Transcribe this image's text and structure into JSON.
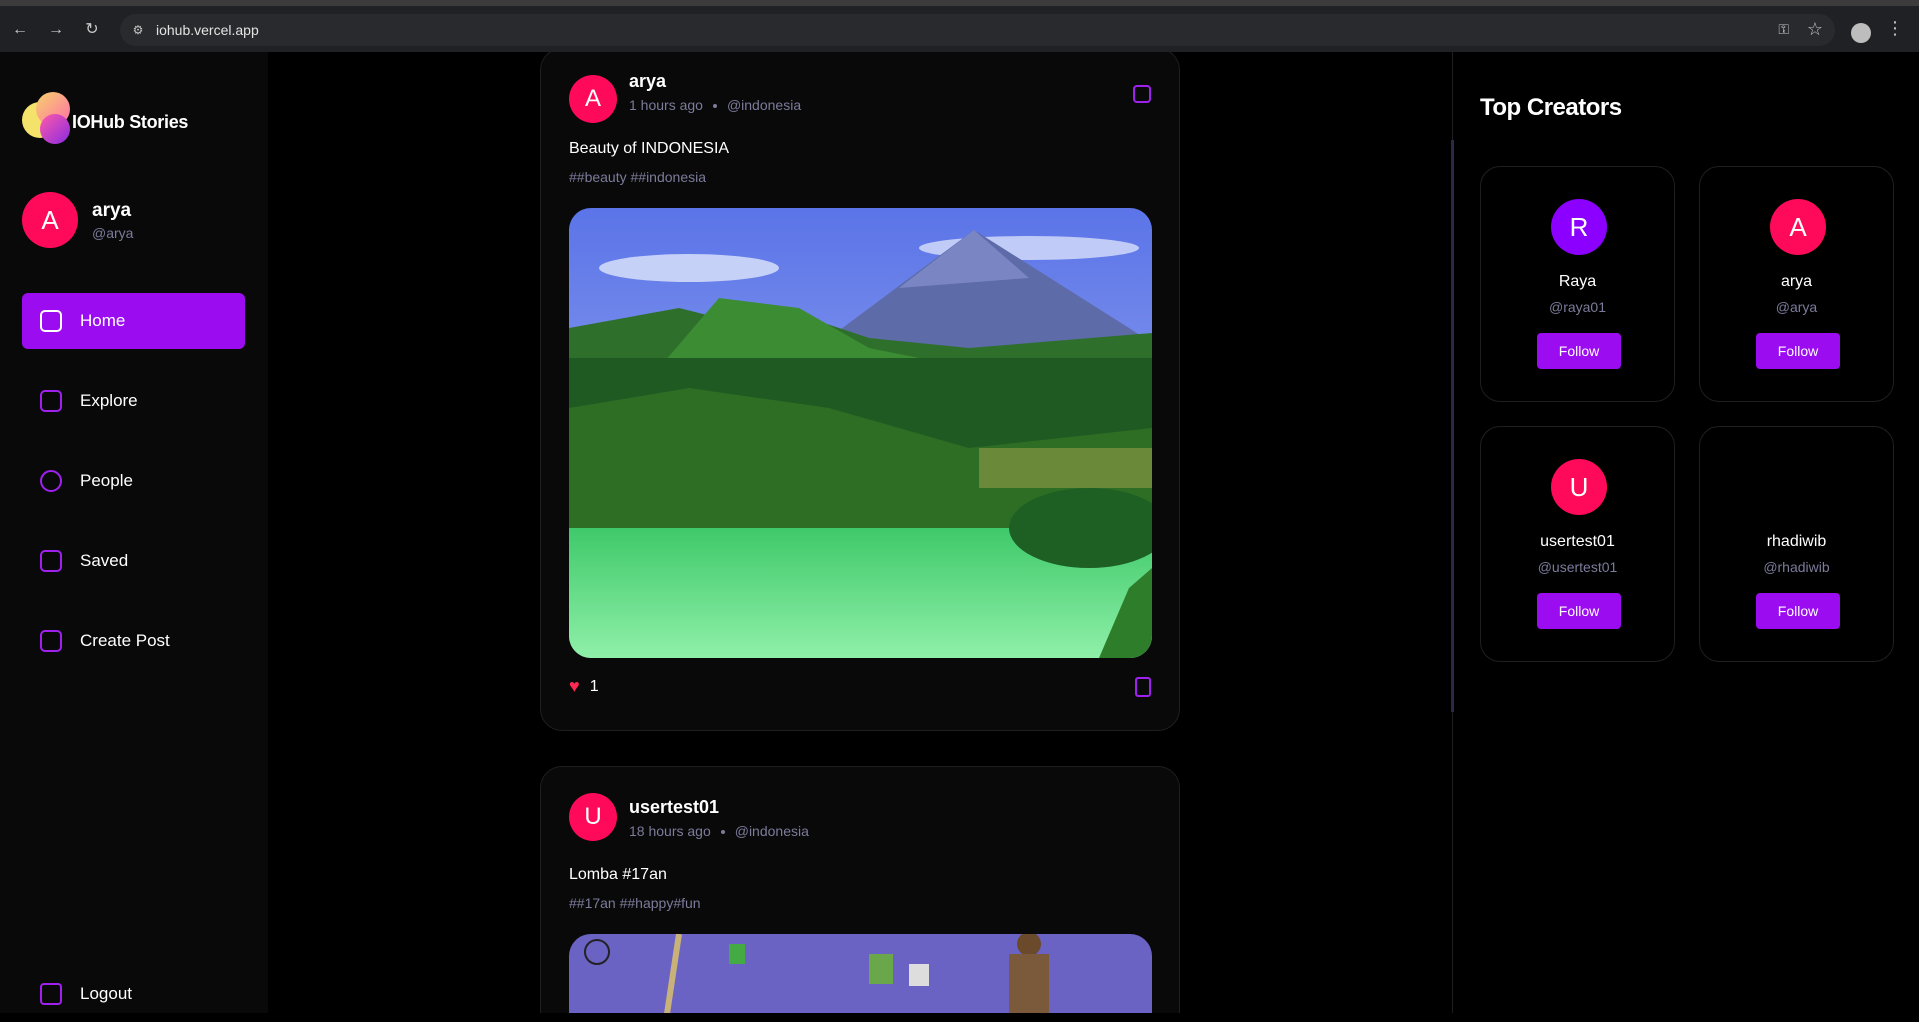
{
  "browser": {
    "url": "iohub.vercel.app",
    "back_icon": "←",
    "forward_icon": "→",
    "reload_icon": "↻",
    "menu_icon": "⋮"
  },
  "sidebar": {
    "app_name": "IOHub Stories",
    "user": {
      "initial": "A",
      "name": "arya",
      "handle": "@arya"
    },
    "items": [
      {
        "label": "Home",
        "icon": "home-icon",
        "active": true
      },
      {
        "label": "Explore",
        "icon": "explore-icon",
        "active": false
      },
      {
        "label": "People",
        "icon": "people-icon",
        "active": false
      },
      {
        "label": "Saved",
        "icon": "bookmark-icon",
        "active": false
      },
      {
        "label": "Create Post",
        "icon": "create-post-icon",
        "active": false
      }
    ],
    "logout_label": "Logout"
  },
  "feed": {
    "posts": [
      {
        "initial": "A",
        "author": "arya",
        "time": "1 hours ago",
        "location": "@indonesia",
        "caption": "Beauty of INDONESIA",
        "tags": "##beauty ##indonesia",
        "likes": "1"
      },
      {
        "initial": "U",
        "author": "usertest01",
        "time": "18 hours ago",
        "location": "@indonesia",
        "caption": "Lomba #17an",
        "tags": "##17an ##happy#fun"
      }
    ]
  },
  "rightbar": {
    "title": "Top Creators",
    "follow_label": "Follow",
    "creators": [
      {
        "initial": "R",
        "name": "Raya",
        "handle": "@raya01",
        "color": "#8b00ff"
      },
      {
        "initial": "A",
        "name": "arya",
        "handle": "@arya",
        "color": "#ff0a5b"
      },
      {
        "initial": "U",
        "name": "usertest01",
        "handle": "@usertest01",
        "color": "#ff0a5b"
      },
      {
        "initial": "",
        "name": "rhadiwib",
        "handle": "@rhadiwib",
        "color": ""
      }
    ]
  },
  "colors": {
    "accent": "#9b0cf0",
    "avatar_pink": "#ff0a5b",
    "muted_text": "#7b7b9a"
  }
}
